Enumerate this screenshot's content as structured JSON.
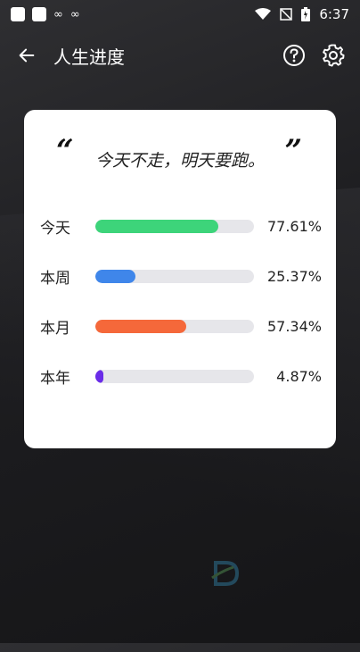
{
  "status_bar": {
    "time": "6:37",
    "left_icons": [
      "app-square-icon",
      "app-square-icon",
      "infinity-icon",
      "infinity-icon"
    ],
    "right_icons": [
      "wifi-icon",
      "no-signal-icon",
      "battery-icon"
    ]
  },
  "app_bar": {
    "title": "人生进度",
    "back_icon": "arrow-left-icon",
    "help_icon": "help-circle-icon",
    "settings_icon": "gear-icon"
  },
  "card": {
    "quote": "今天不走，明天要跑。",
    "open_quote": "“",
    "close_quote": "”",
    "rows": [
      {
        "label": "今天",
        "value": "77.61%",
        "fraction": 0.7761,
        "color": "#3dd47a"
      },
      {
        "label": "本周",
        "value": "25.37%",
        "fraction": 0.2537,
        "color": "#3f86ea"
      },
      {
        "label": "本月",
        "value": "57.34%",
        "fraction": 0.5734,
        "color": "#f5683a"
      },
      {
        "label": "本年",
        "value": "4.87%",
        "fraction": 0.0487,
        "color": "#6a2ce8"
      }
    ]
  }
}
